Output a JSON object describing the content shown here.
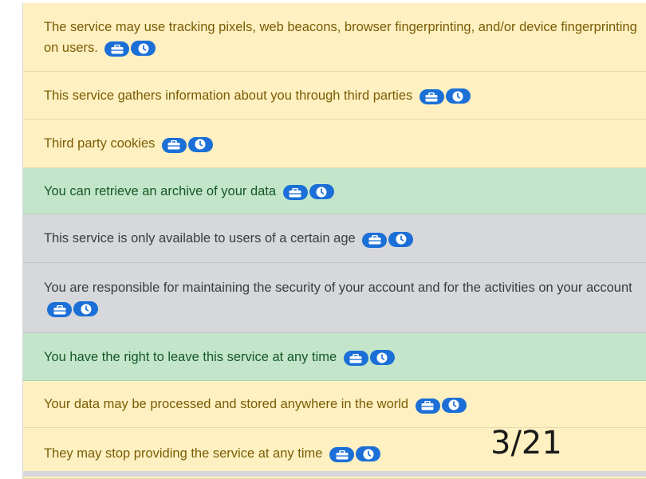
{
  "items": [
    {
      "text": "The service may use tracking pixels, web beacons, browser fingerprinting, and/or device fingerprinting on users.",
      "rating": "neutral",
      "icons": [
        "briefcase-icon",
        "clock-icon"
      ]
    },
    {
      "text": "This service gathers information about you through third parties",
      "rating": "neutral",
      "icons": [
        "briefcase-icon",
        "clock-icon"
      ]
    },
    {
      "text": "Third party cookies",
      "rating": "neutral",
      "icons": [
        "briefcase-icon",
        "clock-icon"
      ]
    },
    {
      "text": "You can retrieve an archive of your data",
      "rating": "good",
      "icons": [
        "briefcase-icon",
        "clock-icon"
      ]
    },
    {
      "text": "This service is only available to users of a certain age",
      "rating": "info",
      "icons": [
        "briefcase-icon",
        "clock-icon"
      ]
    },
    {
      "text": "You are responsible for maintaining the security of your account and for the activities on your account",
      "rating": "info",
      "icons": [
        "briefcase-icon",
        "clock-icon"
      ]
    },
    {
      "text": "You have the right to leave this service at any time",
      "rating": "good",
      "icons": [
        "briefcase-icon",
        "clock-icon"
      ]
    },
    {
      "text": "Your data may be processed and stored anywhere in the world",
      "rating": "neutral",
      "icons": [
        "briefcase-icon",
        "clock-icon"
      ]
    },
    {
      "text": "They may stop providing the service at any time",
      "rating": "neutral",
      "icons": [
        "briefcase-icon",
        "clock-icon"
      ]
    }
  ],
  "colors": {
    "neutral_bg": "#fef0c1",
    "good_bg": "#c3e6cb",
    "info_bg": "#d6d8db",
    "badge": "#1b6fd6"
  },
  "page_counter": "3/21"
}
